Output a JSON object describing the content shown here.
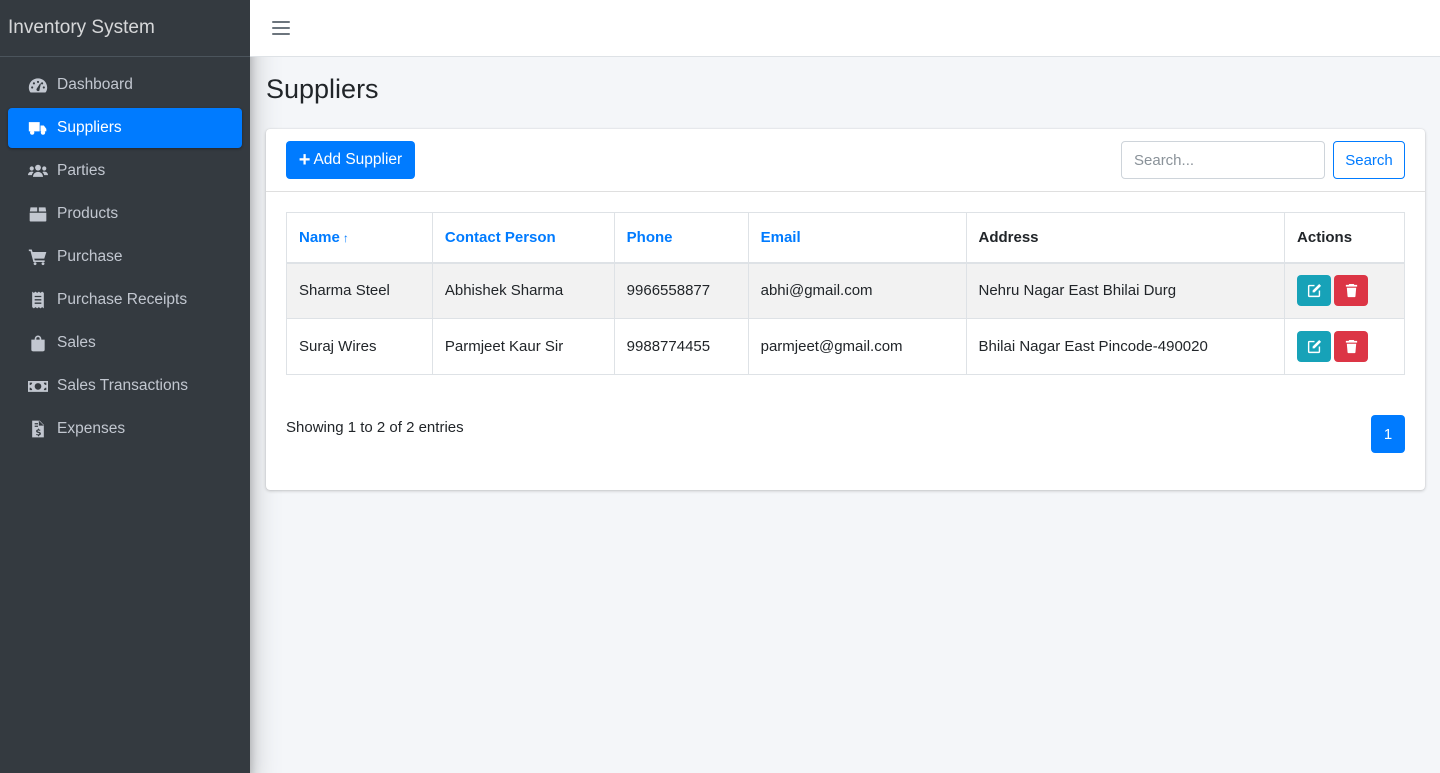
{
  "app": {
    "brand": "Inventory System"
  },
  "sidebar": {
    "items": [
      {
        "label": "Dashboard",
        "icon": "tachometer-icon",
        "active": false
      },
      {
        "label": "Suppliers",
        "icon": "truck-icon",
        "active": true
      },
      {
        "label": "Parties",
        "icon": "users-icon",
        "active": false
      },
      {
        "label": "Products",
        "icon": "box-icon",
        "active": false
      },
      {
        "label": "Purchase",
        "icon": "cart-icon",
        "active": false
      },
      {
        "label": "Purchase Receipts",
        "icon": "receipt-icon",
        "active": false
      },
      {
        "label": "Sales",
        "icon": "shopping-bag-icon",
        "active": false
      },
      {
        "label": "Sales Transactions",
        "icon": "money-bill-icon",
        "active": false
      },
      {
        "label": "Expenses",
        "icon": "invoice-dollar-icon",
        "active": false
      }
    ]
  },
  "page": {
    "title": "Suppliers"
  },
  "toolbar": {
    "add_label": "Add Supplier",
    "search_placeholder": "Search...",
    "search_value": "",
    "search_button": "Search"
  },
  "table": {
    "headers": {
      "name": "Name",
      "contact": "Contact Person",
      "phone": "Phone",
      "email": "Email",
      "address": "Address",
      "actions": "Actions"
    },
    "sort_indicator": "↑",
    "rows": [
      {
        "name": "Sharma Steel",
        "contact": "Abhishek Sharma",
        "phone": "9966558877",
        "email": "abhi@gmail.com",
        "address": "Nehru Nagar East Bhilai Durg"
      },
      {
        "name": "Suraj Wires",
        "contact": "Parmjeet Kaur Sir",
        "phone": "9988774455",
        "email": "parmjeet@gmail.com",
        "address": "Bhilai Nagar East Pincode-490020"
      }
    ]
  },
  "footer": {
    "info": "Showing 1 to 2 of 2 entries",
    "current_page": "1"
  },
  "colors": {
    "primary": "#007bff",
    "sidebar": "#343a40",
    "edit": "#17a2b8",
    "delete": "#dc3545"
  }
}
